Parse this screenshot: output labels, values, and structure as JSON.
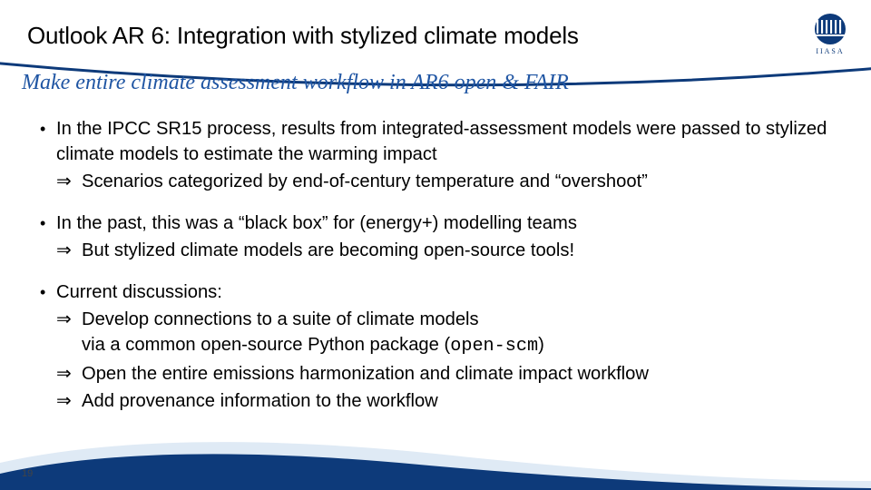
{
  "title": "Outlook AR 6: Integration with stylized climate models",
  "subtitle": "Make entire climate assessment workflow in AR6 open & FAIR",
  "bullets": [
    {
      "lead": "In the IPCC SR15 process, results from integrated-assessment models were passed to stylized climate models to estimate the warming impact",
      "subs": [
        "Scenarios categorized by end-of-century temperature and “overshoot”"
      ]
    },
    {
      "lead": "In the past, this was a “black box” for (energy+) modelling teams",
      "subs": [
        "But stylized climate models are becoming open-source tools!"
      ]
    },
    {
      "lead": "Current discussions:",
      "subs": [
        "Develop connections to a suite of climate models via a common open-source Python package (open-scm)",
        "Open the entire emissions harmonization and climate impact workflow",
        "Add provenance information to the workflow"
      ]
    }
  ],
  "code_token": "open-scm",
  "dot": "•",
  "arrow": "⇒",
  "page_number": "19",
  "logo_text": "IIASA",
  "colors": {
    "accent": "#1f55a3",
    "arc": "#0d3a7a",
    "logo": "#0d3a7a"
  }
}
